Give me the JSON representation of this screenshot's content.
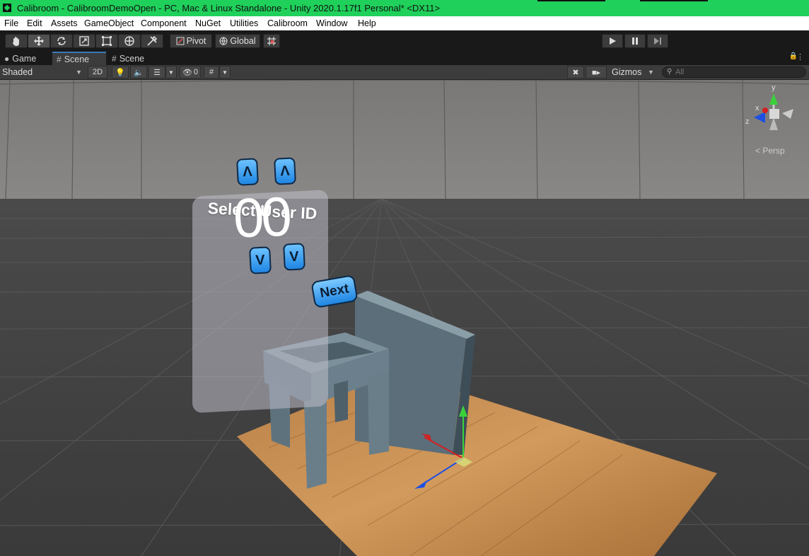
{
  "window": {
    "title": "Calibroom - CalibroomDemoOpen - PC, Mac & Linux Standalone - Unity 2020.1.17f1 Personal* <DX11>",
    "titlebar_color": "#1fd05a"
  },
  "menu": {
    "items": [
      "File",
      "Edit",
      "Assets",
      "GameObject",
      "Component",
      "NuGet",
      "Utilities",
      "Calibroom",
      "Window",
      "Help"
    ]
  },
  "toolbar": {
    "tools": [
      "hand-icon",
      "move-icon",
      "rotate-icon",
      "scale-icon",
      "rect-icon",
      "transform-icon",
      "custom-tool-icon"
    ],
    "pivot_label": "Pivot",
    "global_label": "Global",
    "play_controls": [
      "play-icon",
      "pause-icon",
      "step-icon"
    ]
  },
  "tabs": [
    {
      "label": "Game",
      "icon": "gamepad-icon",
      "active": false
    },
    {
      "label": "Scene",
      "icon": "grid-icon",
      "active": true
    },
    {
      "label": "Scene",
      "icon": "grid-icon",
      "active": false
    }
  ],
  "scene_toolbar": {
    "draw_mode": "Shaded",
    "mode_2d": "2D",
    "hidden_count": "0",
    "gizmos_label": "Gizmos",
    "search_placeholder": "All"
  },
  "scene": {
    "panel_title": "Select User ID",
    "digits": "00",
    "up_glyph": "Λ",
    "down_glyph": "V",
    "next_label": "Next",
    "axis_labels": {
      "x": "x",
      "y": "y",
      "z": "z"
    },
    "projection": "< Persp",
    "colors": {
      "button_blue": "#2a90ea",
      "floor_wood": "#c58a4a",
      "furniture": "#6a7f8c",
      "axis_x": "#d42020",
      "axis_y": "#3ad23a",
      "axis_z": "#2050e0"
    }
  }
}
